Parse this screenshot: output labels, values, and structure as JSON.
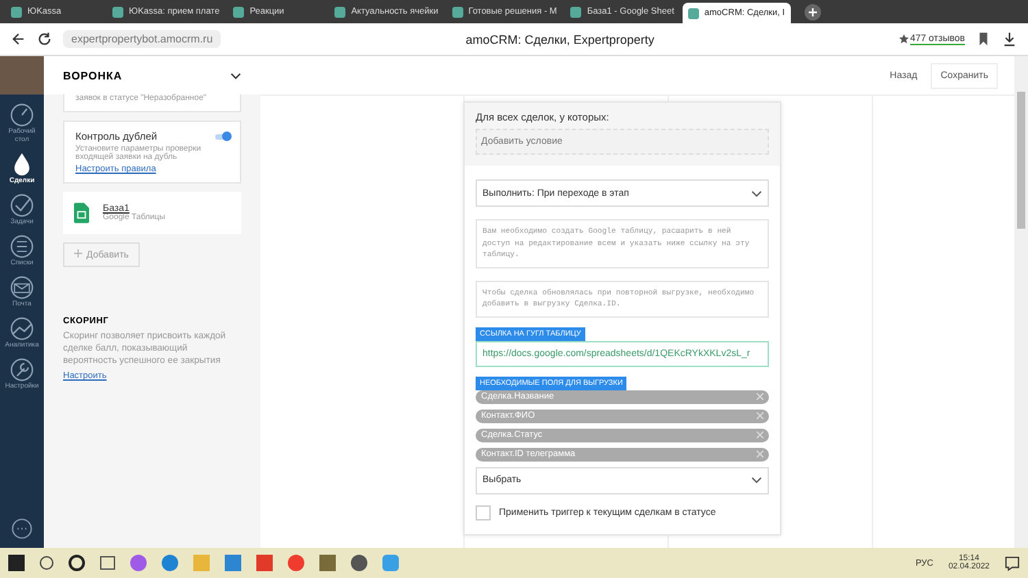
{
  "browser": {
    "tabs": [
      {
        "title": "ЮKassa",
        "selected": false
      },
      {
        "title": "ЮKassa: прием плате",
        "selected": false
      },
      {
        "title": "Реакции",
        "selected": false
      },
      {
        "title": "Актуальность ячейки",
        "selected": false
      },
      {
        "title": "Готовые решения - M",
        "selected": false
      },
      {
        "title": "База1 - Google Sheet",
        "selected": false
      },
      {
        "title": "amoCRM: Сделки, I",
        "selected": true
      }
    ],
    "address": "expertpropertybot.amocrm.ru",
    "page_title": "amoCRM: Сделки, Expertproperty",
    "reviews": "477 отзывов"
  },
  "nav": [
    {
      "label": "Рабочий стол",
      "kind": "gauge",
      "selected": false
    },
    {
      "label": "Сделки",
      "kind": "drop",
      "selected": true
    },
    {
      "label": "Задачи",
      "kind": "check",
      "selected": false
    },
    {
      "label": "Списки",
      "kind": "list",
      "selected": false
    },
    {
      "label": "Почта",
      "kind": "mail",
      "selected": false
    },
    {
      "label": "Аналитика",
      "kind": "chart",
      "selected": false
    },
    {
      "label": "Настройки",
      "kind": "wrench",
      "selected": false
    }
  ],
  "panel": {
    "title": "ВОРОНКА",
    "cut_card_text": "заявок в статусе \"Неразобранное\"",
    "duplicates": {
      "title": "Контроль дублей",
      "on": true,
      "description": "Установите параметры проверки входящей заявки на дубль",
      "link": "Настроить правила"
    },
    "integration": {
      "name": "База1",
      "subtitle": "Google Таблицы"
    },
    "add_button": "Добавить",
    "scoring": {
      "title": "СКОРИНГ",
      "text": "Скоринг позволяет присвоить каждой сделке балл, показывающий вероятность успешного ее закрытия",
      "link": "Настроить"
    }
  },
  "header": {
    "back": "Назад",
    "save": "Сохранить"
  },
  "form": {
    "condition_label": "Для всех сделок, у которых:",
    "condition_placeholder": "Добавить условие",
    "execute": "Выполнить: При переходе в этап",
    "notes": [
      "Вам необходимо создать Google таблицу, расшарить в ней доступ на редактирование всем и указать ниже ссылку на эту таблицу.",
      "Чтобы сделка обновлялась при повторной выгрузке, необходимо добавить в выгрузку Сделка.ID."
    ],
    "link_label": "ССЫЛКА НА ГУГЛ ТАБЛИЦУ",
    "link_value": "https://docs.google.com/spreadsheets/d/1QEKcRYkXKLv2sL_r",
    "fields_label": "НЕОБХОДИМЫЕ ПОЛЯ ДЛЯ ВЫГРУЗКИ",
    "fields": [
      "Сделка.Название",
      "Контакт.ФИО",
      "Сделка.Статус",
      "Контакт.ID телеграмма"
    ],
    "select": "Выбрать",
    "apply_trigger": {
      "label": "Применить триггер к текущим сделкам в статусе",
      "checked": false
    }
  },
  "taskbar": {
    "lang": "РУС",
    "time": "15:14",
    "date": "02.04.2022"
  }
}
